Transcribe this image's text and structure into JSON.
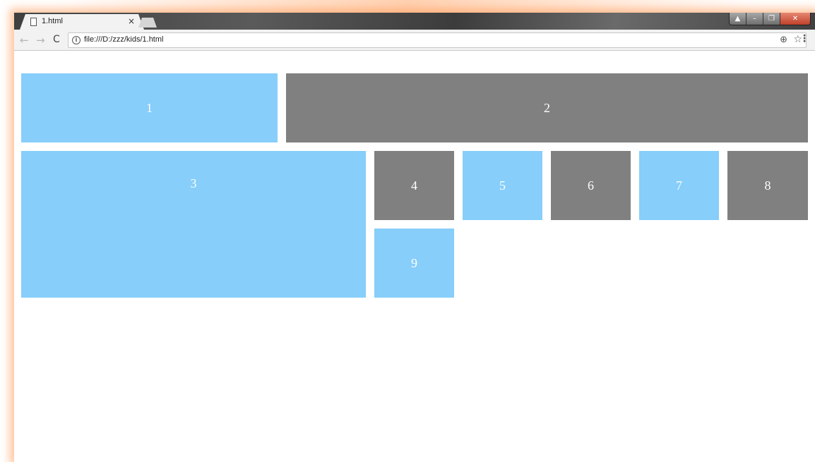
{
  "browser": {
    "tab_title": "1.html",
    "tab_close": "×",
    "url": "file:///D:/zzz/kids/1.html",
    "icons": {
      "back": "back-arrow-icon",
      "forward": "forward-arrow-icon",
      "reload": "reload-icon",
      "info": "info-icon",
      "zoom": "zoom-icon",
      "bookmark": "star-icon",
      "menu": "menu-icon"
    }
  },
  "page": {
    "colors": {
      "blue": "#87cefa",
      "gray": "#808080"
    },
    "boxes": [
      {
        "label": "1",
        "color": "blue"
      },
      {
        "label": "2",
        "color": "gray"
      },
      {
        "label": "3",
        "color": "blue"
      },
      {
        "label": "4",
        "color": "gray"
      },
      {
        "label": "5",
        "color": "blue"
      },
      {
        "label": "6",
        "color": "gray"
      },
      {
        "label": "7",
        "color": "blue"
      },
      {
        "label": "8",
        "color": "gray"
      },
      {
        "label": "9",
        "color": "blue"
      }
    ]
  }
}
